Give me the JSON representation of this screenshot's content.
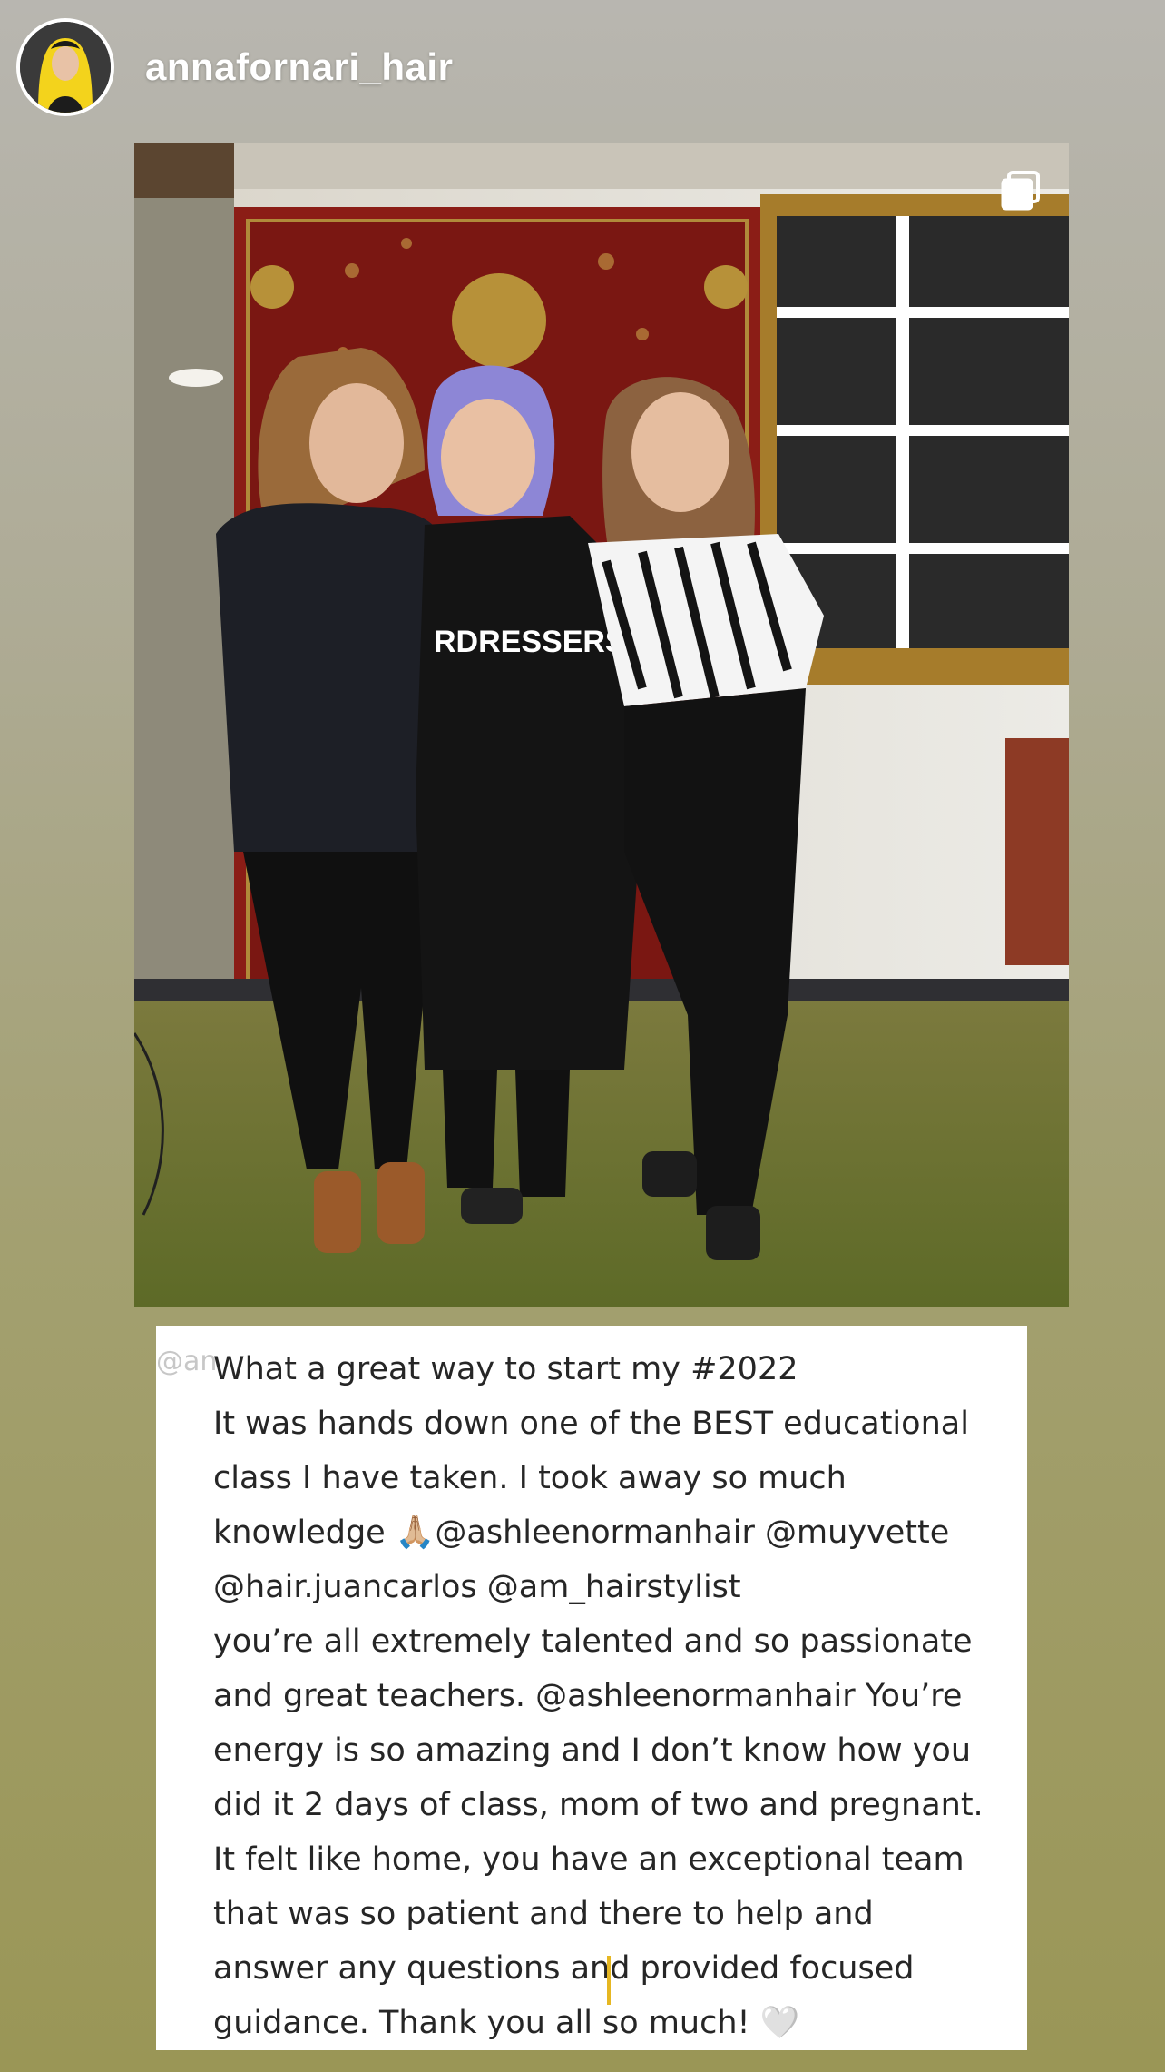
{
  "header": {
    "username": "annafornari_hair",
    "avatar_icon": "profile-avatar"
  },
  "post": {
    "image_alt": "Three women posing in a salon in front of a red lacquered cabinet and a gilded mirror",
    "multi_image_icon": "multiple-photos-icon",
    "shirt_text": "RDRESSERS CK"
  },
  "caption": {
    "overlap_tag": "@an",
    "lines": [
      "What a great way to start my #2022",
      "It was hands down one of the BEST educational",
      "class I have taken. I took away so much",
      "knowledge 🙏🏼@ashleenormanhair @muyvette",
      "@hair.juancarlos @am_hairstylist",
      "you’re all extremely talented and so passionate",
      "and great teachers. @ashleenormanhair You’re",
      "energy is so amazing and I don’t know how you",
      "did it 2 days of class, mom of two and pregnant.",
      "It felt like home, you have an exceptional team",
      "that was so patient and there to help and",
      "answer any questions and provided focused",
      "guidance. Thank you all so much! 🤍"
    ]
  },
  "colors": {
    "text": "#262626",
    "accent_cursor": "#e6b722",
    "card": "#ffffff"
  }
}
